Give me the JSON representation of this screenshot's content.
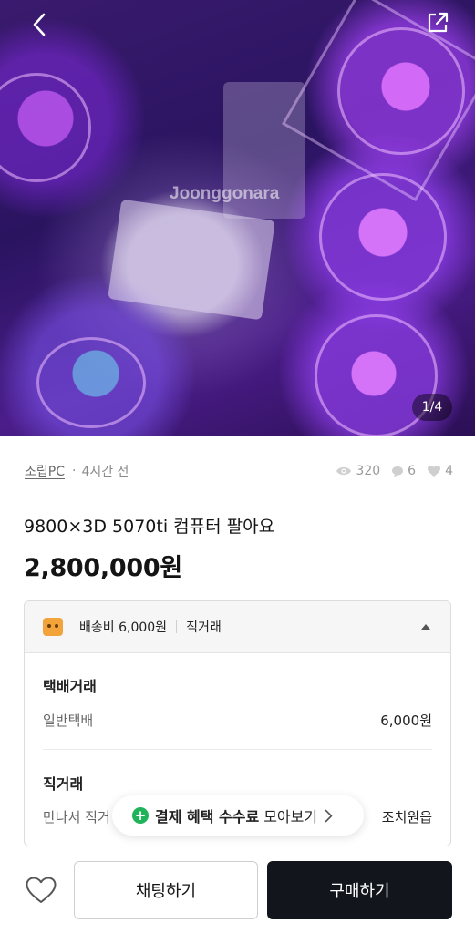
{
  "photo": {
    "watermark": "Joonggonara",
    "counter": "1/4"
  },
  "meta": {
    "category": "조립PC",
    "time": "4시간 전",
    "views": "320",
    "chats": "6",
    "likes": "4"
  },
  "product": {
    "title": "9800×3D 5070ti 컴퓨터 팔아요",
    "price": "2,800,000원"
  },
  "delivery": {
    "shipping_fee": "배송비 6,000원",
    "direct": "직거래",
    "parcel_section": "택배거래",
    "parcel_type": "일반택배",
    "parcel_price": "6,000원",
    "direct_section": "직거래",
    "direct_text": "만나서 직거",
    "direct_link_partial": "읍",
    "direct_link": "조치원읍"
  },
  "promo": {
    "bold": "결제 혜택 수수료",
    "normal": "모아보기"
  },
  "actions": {
    "chat": "채팅하기",
    "buy": "구매하기"
  },
  "colors": {
    "buy_bg": "#12161c",
    "accent_green": "#1fb35a",
    "shipping_icon": "#f2a43a"
  }
}
